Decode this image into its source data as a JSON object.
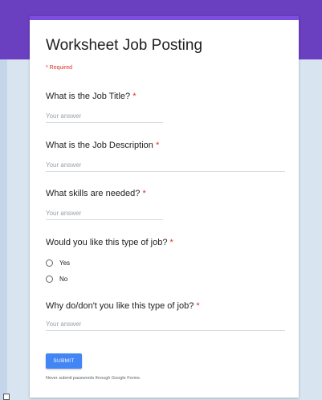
{
  "form": {
    "title": "Worksheet Job Posting",
    "required_note": "* Required",
    "star": "*"
  },
  "questions": [
    {
      "label": "What is the Job Title? ",
      "placeholder": "Your answer"
    },
    {
      "label": "What is the Job Description ",
      "placeholder": "Your answer"
    },
    {
      "label": "What skills are needed? ",
      "placeholder": "Your answer"
    },
    {
      "label": "Would you like this type of job? ",
      "options": [
        "Yes",
        "No"
      ]
    },
    {
      "label": "Why do/don't you like this type of job? ",
      "placeholder": "Your answer"
    }
  ],
  "submit_label": "SUBMIT",
  "disclaimer": "Never submit passwords through Google Forms.",
  "colors": {
    "header": "#6a3fc0",
    "accent": "#7c4ee0",
    "button": "#4285f4",
    "required": "#d93025"
  }
}
